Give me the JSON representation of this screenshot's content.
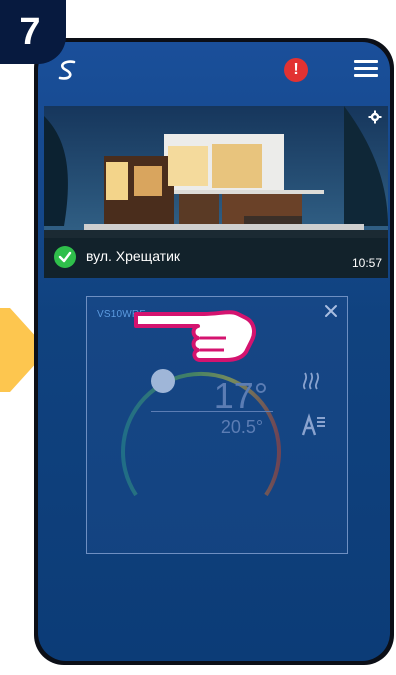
{
  "step": {
    "number": "7"
  },
  "header": {
    "logo_icon": "app-logo-icon",
    "alert_icon": "alert-icon",
    "alert_text": "!",
    "menu_icon": "hamburger-menu-icon"
  },
  "location_card": {
    "address": "вул. Хрещатик",
    "time": "10:57",
    "status_icon": "check-icon",
    "settings_icon": "gear-icon"
  },
  "device_tile": {
    "name": "VS10WRF",
    "set_temperature": "17°",
    "current_temperature": "20.5°",
    "mode_icon": "heating-icon",
    "auto_icon": "auto-mode-icon",
    "close_icon": "close-icon"
  },
  "colors": {
    "screen_top": "#1a4f9a",
    "screen_bottom": "#0c3c77",
    "accent_yellow": "#fdc64f",
    "hand_pink": "#d4136f",
    "status_green": "#2fbf4b",
    "alert_red": "#e23232"
  }
}
